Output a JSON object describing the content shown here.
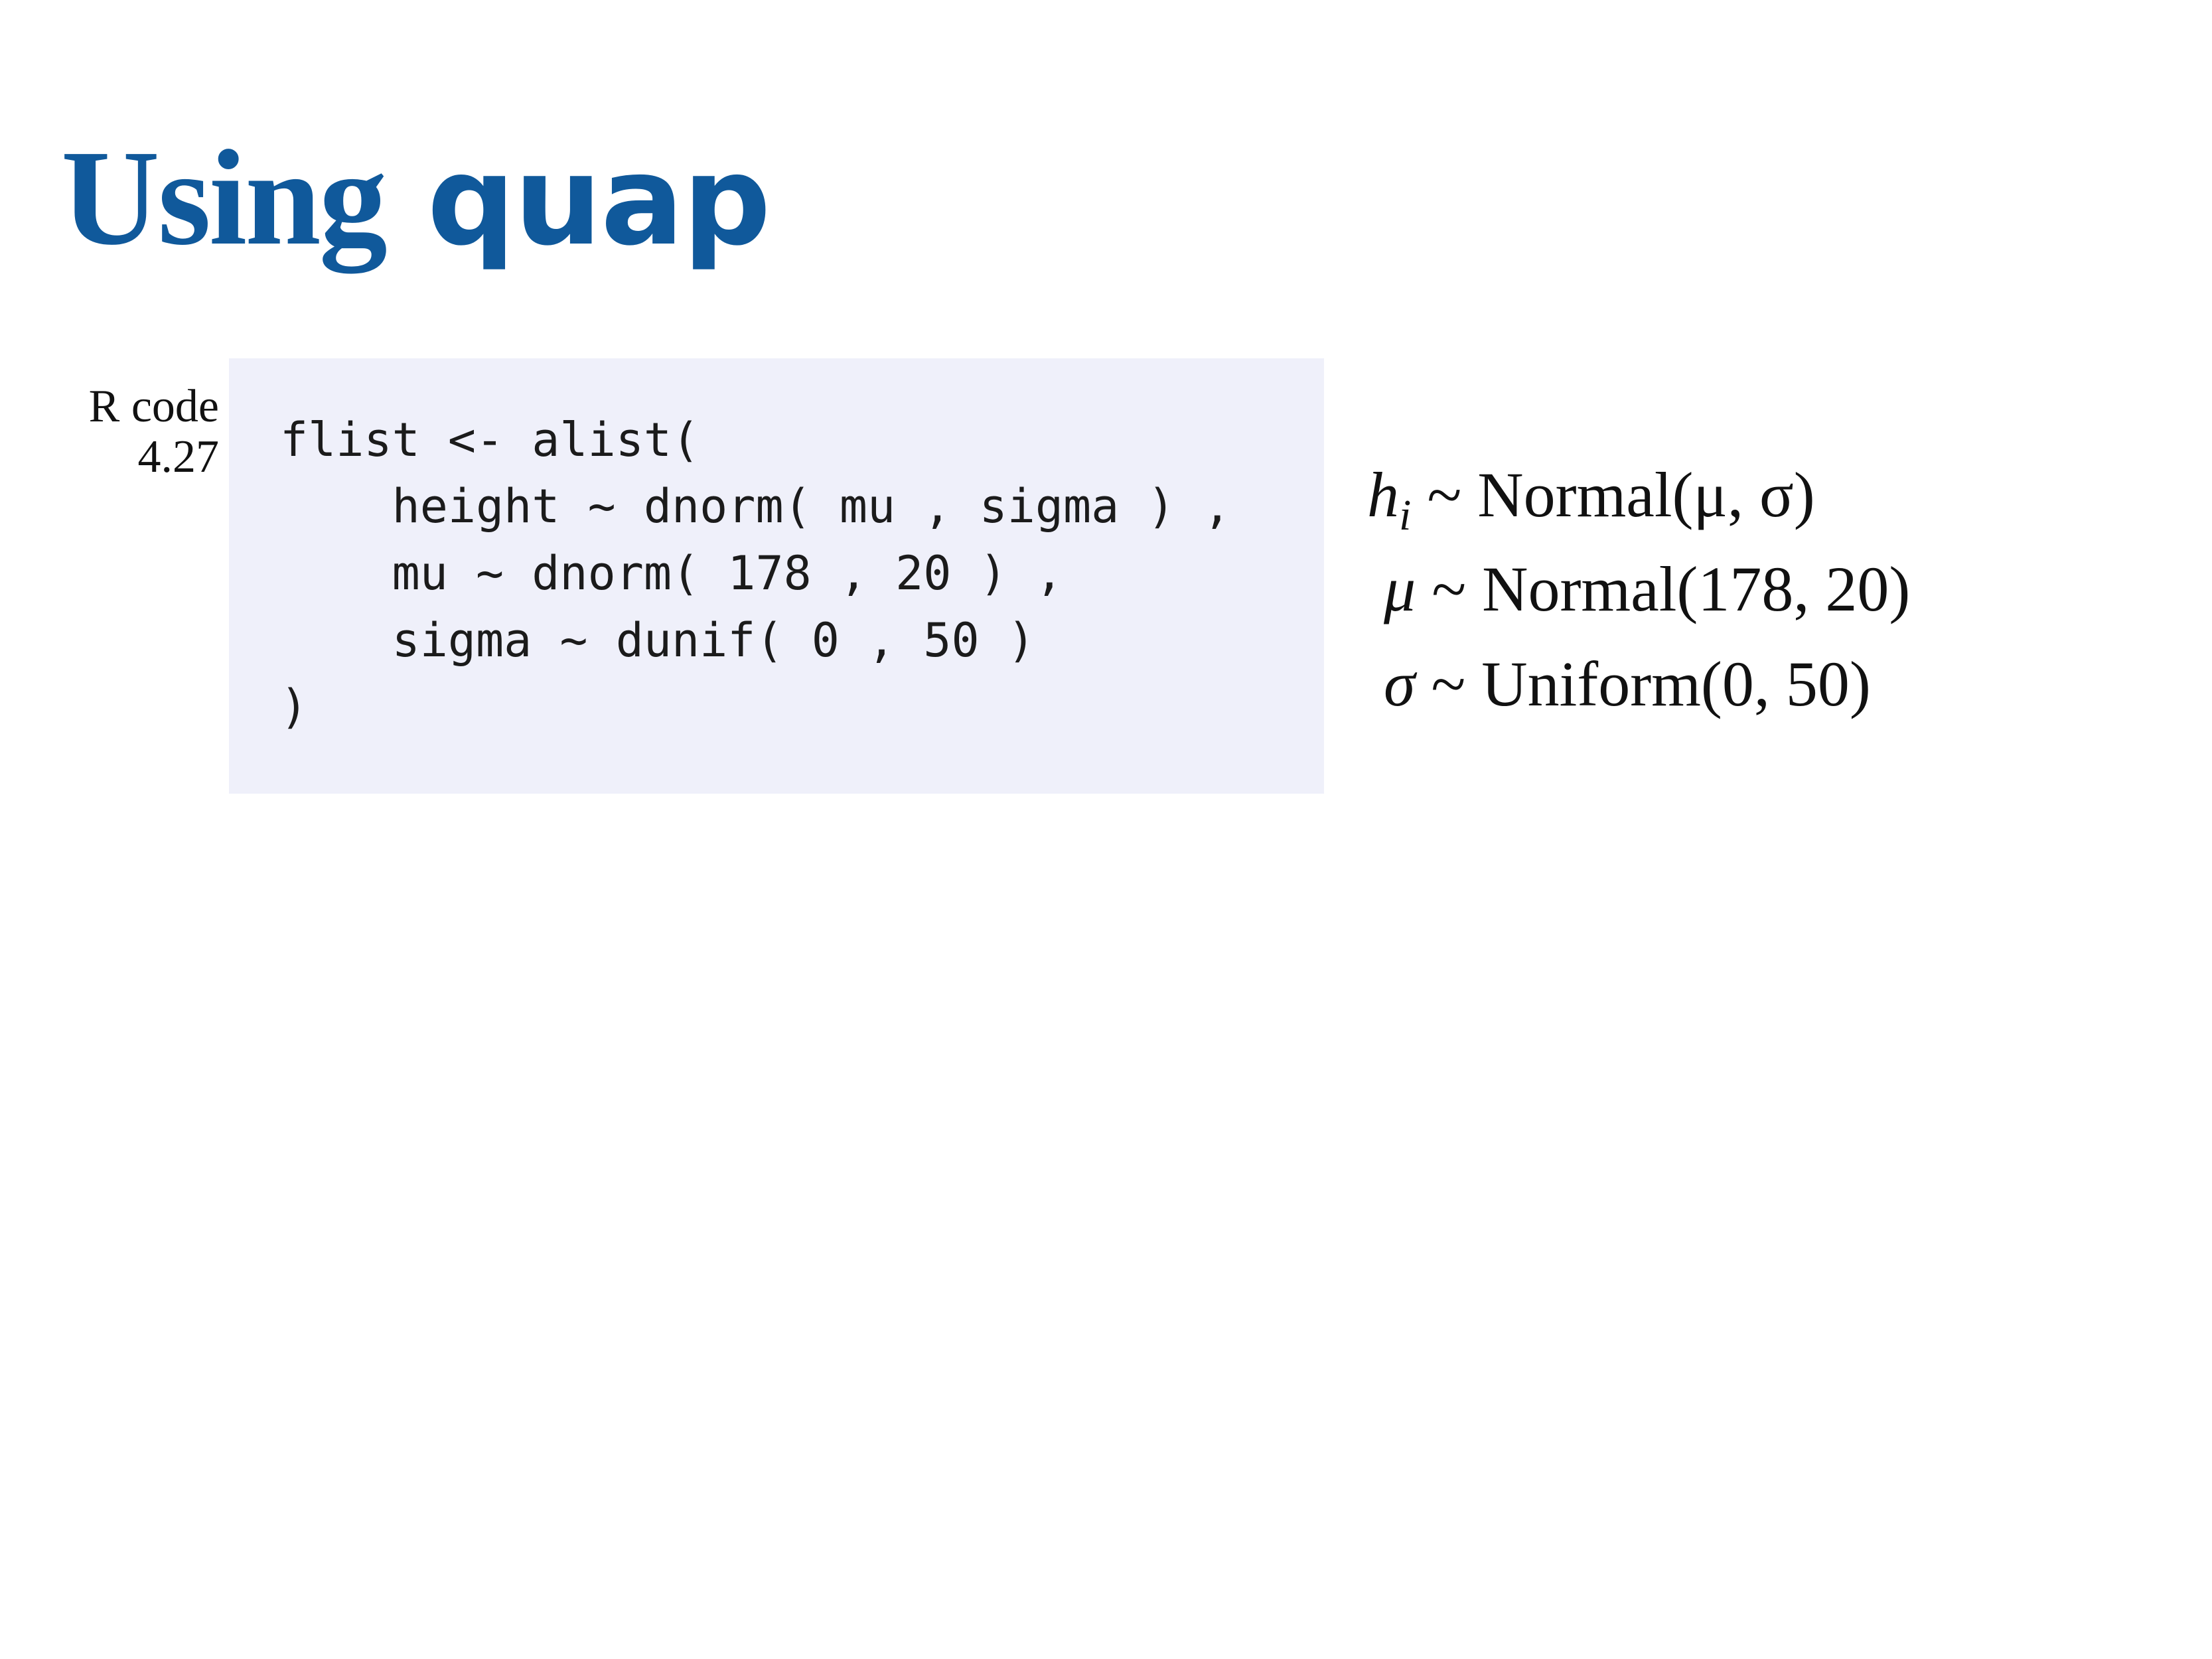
{
  "slide": {
    "title_word1": "Using",
    "title_word2": "quap"
  },
  "code_label": {
    "line1": "R code",
    "line2": "4.27"
  },
  "code": {
    "lines": [
      "flist <- alist(",
      "    height ~ dnorm( mu , sigma ) ,",
      "    mu ~ dnorm( 178 , 20 ) ,",
      "    sigma ~ dunif( 0 , 50 )",
      ")"
    ]
  },
  "model": {
    "eq1": {
      "lhs": "h",
      "lhs_sub": "i",
      "op": "~",
      "dist": "Normal",
      "args": "(μ, σ)"
    },
    "eq2": {
      "lhs": "μ",
      "op": "~",
      "dist": "Normal",
      "args": "(178, 20)"
    },
    "eq3": {
      "lhs": "σ",
      "op": "~",
      "dist": "Uniform",
      "args": "(0, 50)"
    }
  }
}
